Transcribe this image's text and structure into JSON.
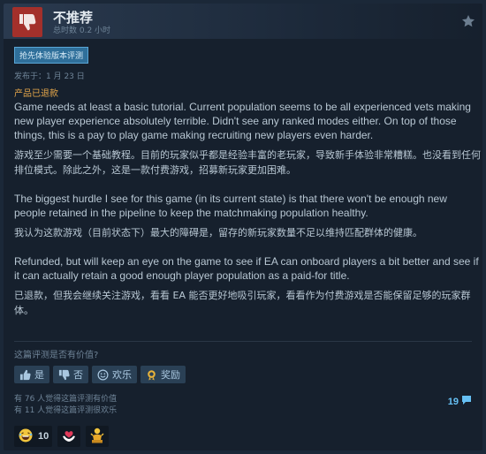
{
  "review": {
    "verdict": "不推荐",
    "hours": "总时数 0.2 小时",
    "early_access_badge": "抢先体验版本评测",
    "posted": "发布于：1 月 23 日",
    "status_tag": "产品已退款",
    "paragraphs": [
      {
        "en": "Game needs at least a basic tutorial. Current population seems to be all experienced vets making new player experience absolutely terrible. Didn't see any ranked modes either. On top of those things, this is a pay to play game making recruiting new players even harder.",
        "cn": "游戏至少需要一个基础教程。目前的玩家似乎都是经验丰富的老玩家，导致新手体验非常糟糕。也没看到任何排位模式。除此之外，这是一款付费游戏，招募新玩家更加困难。"
      },
      {
        "en": "The biggest hurdle I see for this game (in its current state) is that there won't be enough new people retained in the pipeline to keep the matchmaking population healthy.",
        "cn": "我认为这款游戏（目前状态下）最大的障碍是，留存的新玩家数量不足以维持匹配群体的健康。"
      },
      {
        "en": "Refunded, but will keep an eye on the game to see if EA can onboard players a bit better and see if it can actually retain a good enough player population as a paid-for title.",
        "cn": "已退款，但我会继续关注游戏，看看 EA 能否更好地吸引玩家，看看作为付费游戏是否能保留足够的玩家群体。"
      }
    ]
  },
  "feedback": {
    "question": "这篇评测是否有价值?",
    "buttons": {
      "yes": "是",
      "no": "否",
      "funny": "欢乐",
      "award": "奖励"
    },
    "helpful_stat": "有 76 人觉得这篇评测有价值",
    "funny_stat": "有 11 人觉得这篇评测很欢乐",
    "comment_count": "19"
  },
  "awards": [
    {
      "icon": "laughing-face-award-icon",
      "count": "10"
    },
    {
      "icon": "heart-hands-award-icon",
      "count": ""
    },
    {
      "icon": "gold-figure-award-icon",
      "count": ""
    }
  ],
  "colors": {
    "background": "#1b2838",
    "thumb_down_bg": "#a3302b",
    "refunded_tag": "#e5a64a",
    "link_blue": "#66c0f4"
  }
}
